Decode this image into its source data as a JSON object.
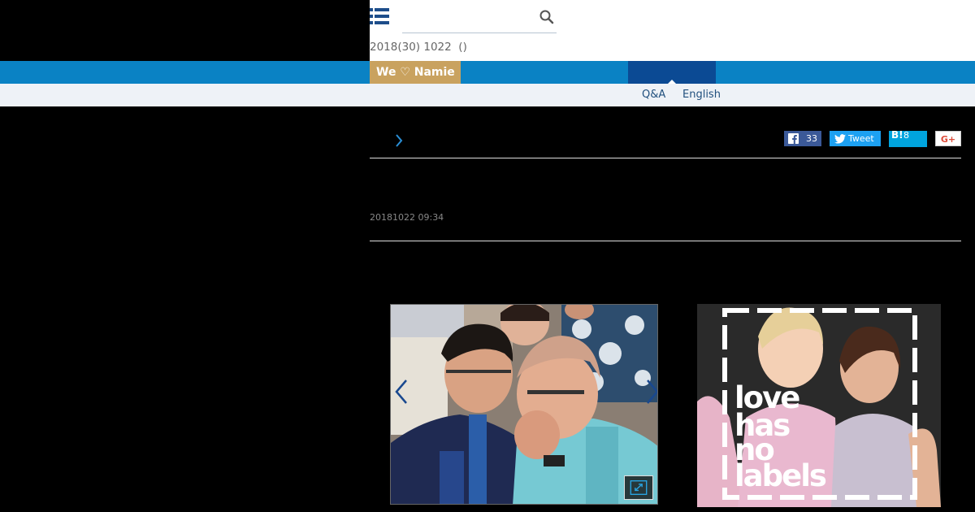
{
  "header": {
    "search_placeholder": "",
    "date_line": "2018(30) 1022  ()"
  },
  "nav": {
    "badge_label": "We ♡ Namie"
  },
  "sub_nav": {
    "qa_label": "Q&A",
    "english_label": "English"
  },
  "share": {
    "facebook_count": "33",
    "tweet_label": "Tweet",
    "hatena_label": "B!",
    "hatena_count": "8",
    "gplus_label": "G+"
  },
  "article": {
    "timestamp": "20181022 09:34"
  },
  "ad": {
    "line1": "love",
    "line2": "has",
    "line3": "no",
    "line4": "labels"
  },
  "colors": {
    "nav_blue": "#0a82c4",
    "nav_active": "#0b4a94",
    "badge_gold": "#c9a25f",
    "subnav_bg": "#eef2f7"
  },
  "icons": [
    "menu-icon",
    "search-icon",
    "chevron-right-icon",
    "facebook-icon",
    "twitter-icon",
    "expand-icon",
    "chevron-left-icon"
  ]
}
